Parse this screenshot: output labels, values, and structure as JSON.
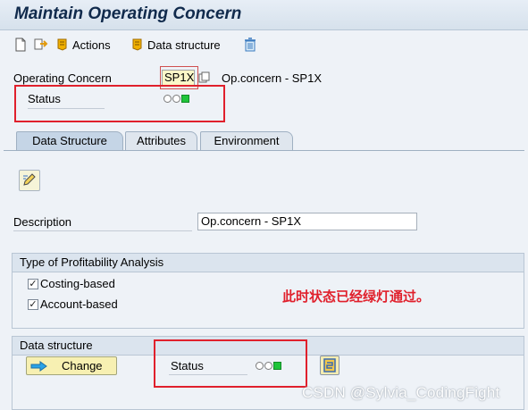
{
  "window": {
    "title": "Maintain Operating Concern"
  },
  "toolbar": {
    "actions_label": "Actions",
    "data_structure_label": "Data structure"
  },
  "header": {
    "operating_concern_label": "Operating Concern",
    "operating_concern_value": "SP1X",
    "operating_concern_text": "Op.concern - SP1X",
    "status_label": "Status"
  },
  "tabs": [
    {
      "label": "Data Structure",
      "active": true
    },
    {
      "label": "Attributes",
      "active": false
    },
    {
      "label": "Environment",
      "active": false
    }
  ],
  "form": {
    "description_label": "Description",
    "description_value": "Op.concern - SP1X"
  },
  "profitability": {
    "title": "Type of Profitability Analysis",
    "costing_label": "Costing-based",
    "costing_checked": true,
    "account_label": "Account-based",
    "account_checked": true
  },
  "annotation": "此时状态已经绿灯通过。",
  "data_structure_group": {
    "title": "Data structure",
    "change_label": "Change",
    "status_label": "Status"
  },
  "watermark": "CSDN @Sylvia_CodingFight",
  "colors": {
    "status_green": "#1fc43a",
    "highlight_red": "#e0202c",
    "title_blue": "#102a4c"
  }
}
